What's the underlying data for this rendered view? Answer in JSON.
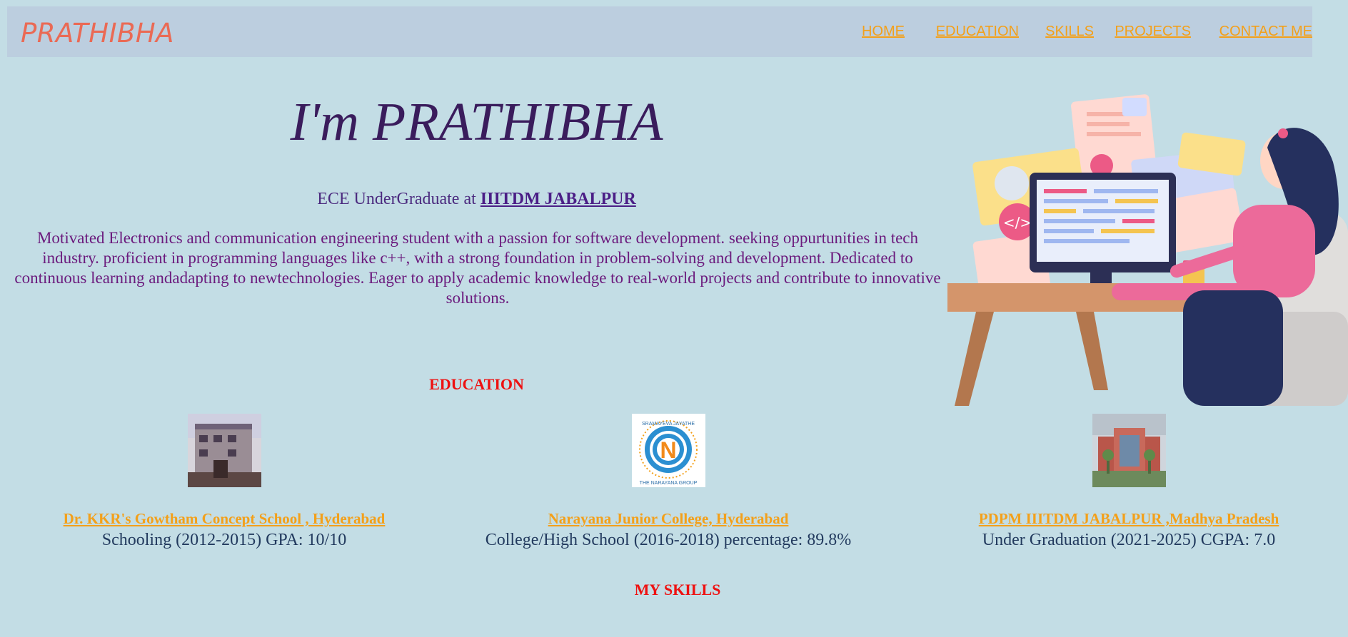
{
  "nav": {
    "brand": "PRATHIBHA",
    "links": [
      "HOME",
      "EDUCATION",
      "SKILLS",
      "PROJECTS",
      "CONTACT ME"
    ]
  },
  "hero": {
    "title": "I'm PRATHIBHA",
    "subtitle_prefix": "ECE UnderGraduate at",
    "institute_link": "IIITDM JABALPUR",
    "bio": "Motivated Electronics and communication engineering student with a passion for software development. seeking oppurtunities in tech industry. proficient in programming languages like c++, with a strong foundation in problem-solving and development. Dedicated to continuous learning andadapting to newtechnologies. Eager to apply academic knowledge to real-world projects and contribute to innovative solutions."
  },
  "education": {
    "heading": "EDUCATION",
    "items": [
      {
        "name": "Dr. KKR's Gowtham Concept School , Hyderabad",
        "detail": "Schooling (2012-2015) GPA: 10/10"
      },
      {
        "name": "Narayana Junior College, Hyderabad",
        "detail": "College/High School (2016-2018) percentage: 89.8%",
        "logo_top_text": "SRAMAYEVA JAYATHE",
        "logo_letter": "N",
        "logo_bottom_text": "THE NARAYANA GROUP"
      },
      {
        "name": "PDPM IIITDM JABALPUR ,Madhya Pradesh",
        "detail": "Under Graduation (2021-2025) CGPA: 7.0"
      }
    ]
  },
  "skills": {
    "heading": "MY SKILLS"
  },
  "colors": {
    "page_bg": "#c3dde5",
    "nav_bg": "#bccedf",
    "brand": "#ea6a55",
    "nav_link": "#f3a01a",
    "heading_red": "#ee1111",
    "title_purple": "#3a1c5c"
  }
}
